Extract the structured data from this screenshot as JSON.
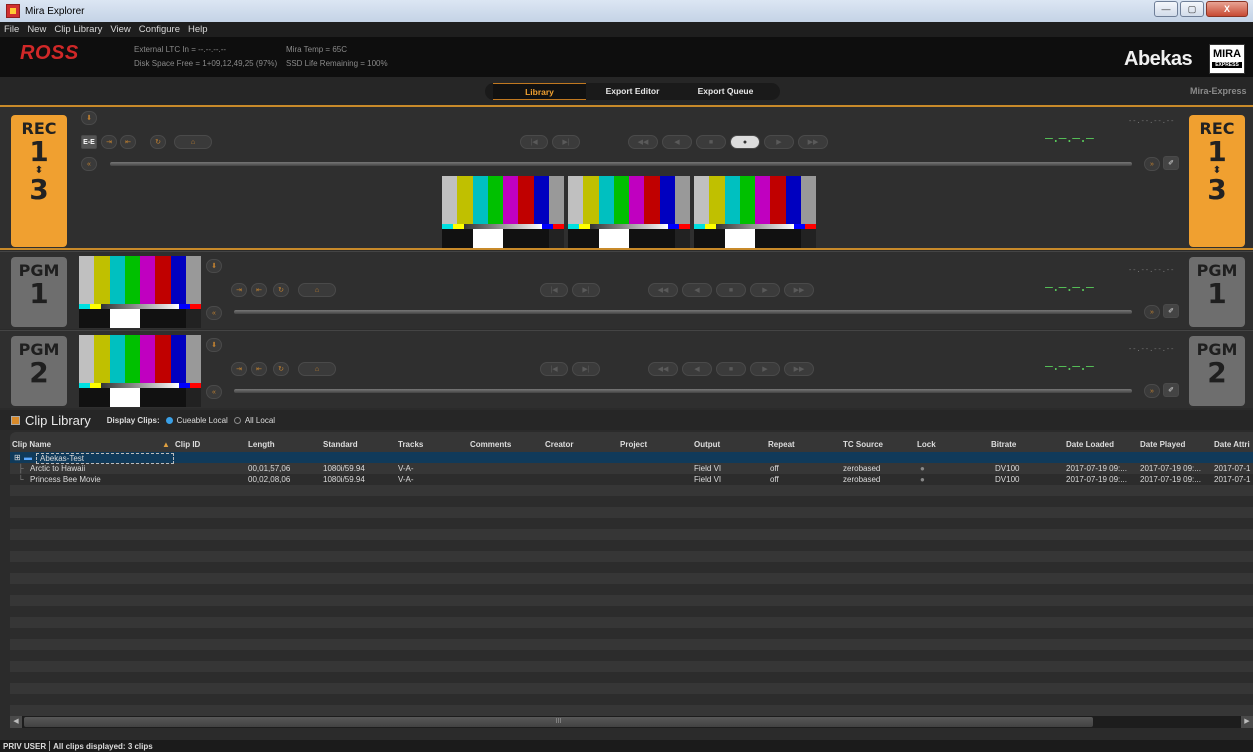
{
  "window": {
    "title": "Mira Explorer",
    "buttons": [
      "—",
      "▢",
      "X"
    ]
  },
  "menu": [
    "File",
    "New",
    "Clip Library",
    "View",
    "Configure",
    "Help"
  ],
  "header": {
    "logo": "ROSS",
    "external_ltc": "External LTC In = --.--.--.--",
    "mira_temp": "Mira Temp = 65C",
    "disk_space": "Disk Space Free = 1+09,12,49,25 (97%)",
    "ssd_life": "SSD Life Remaining = 100%",
    "brand": "Abekas",
    "badge_top": "MIRA",
    "badge_bottom": "EXPRESS"
  },
  "tabs": [
    {
      "label": "Library",
      "active": true
    },
    {
      "label": "Export Editor",
      "active": false
    },
    {
      "label": "Export Queue",
      "active": false
    }
  ],
  "product": "Mira-Express",
  "channels": {
    "rec": {
      "label": "REC",
      "num_top": "1",
      "arrow": "⬍",
      "num_bottom": "3",
      "tc": "—.—.—.—",
      "tc_small": "--.--.--.--",
      "ee": "E-E"
    },
    "pgm1": {
      "label": "PGM",
      "num": "1",
      "tc": "—.—.—.—",
      "tc_small": "--.--.--.--"
    },
    "pgm2": {
      "label": "PGM",
      "num": "2",
      "tc": "—.—.—.—",
      "tc_small": "--.--.--.--"
    }
  },
  "colors": {
    "accent": "#f0a030",
    "tc_green": "#58c85a",
    "ross_red": "#d02828",
    "radio_blue": "#3aa0e6"
  },
  "library": {
    "title": "Clip Library",
    "display_label": "Display Clips:",
    "options": [
      {
        "label": "Cueable Local",
        "selected": true
      },
      {
        "label": "All Local",
        "selected": false
      }
    ],
    "columns": [
      "Clip Name",
      "Clip ID",
      "Length",
      "Standard",
      "Tracks",
      "Comments",
      "Creator",
      "Project",
      "Output",
      "Repeat",
      "TC Source",
      "Lock",
      "Bitrate",
      "Date Loaded",
      "Date Played",
      "Date Attri"
    ],
    "folder": "Abekas-Test",
    "rows": [
      {
        "name": "Arctic to Hawaii",
        "length_pre": "00,0",
        "length": "1,57,06",
        "standard": "1080i/59.94",
        "tracks": "V-A-",
        "output": "Field VI",
        "repeat": "off",
        "tc_source": "zerobased",
        "bitrate": "DV100",
        "date_loaded": "2017-07-19 09:...",
        "date_played": "2017-07-19 09:...",
        "date_attr": "2017-07-1"
      },
      {
        "name": "Princess Bee Movie",
        "length_pre": "00,0",
        "length": "2,08,06",
        "standard": "1080i/59.94",
        "tracks": "V-A-",
        "output": "Field VI",
        "repeat": "off",
        "tc_source": "zerobased",
        "bitrate": "DV100",
        "date_loaded": "2017-07-19 09:...",
        "date_played": "2017-07-19 09:...",
        "date_attr": "2017-07-1"
      }
    ],
    "scroll_mark": "III"
  },
  "status": {
    "user": "PRIV USER",
    "message": "All clips displayed: 3 clips"
  }
}
